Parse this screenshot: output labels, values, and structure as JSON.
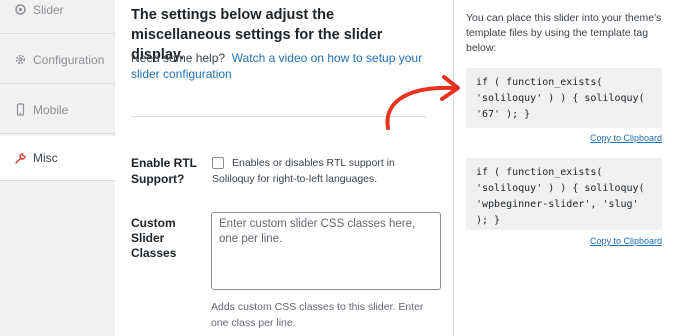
{
  "sidebar": {
    "items": [
      {
        "label": "Slider",
        "icon": "slider-icon"
      },
      {
        "label": "Configuration",
        "icon": "gear-icon"
      },
      {
        "label": "Mobile",
        "icon": "mobile-icon"
      },
      {
        "label": "Misc",
        "icon": "wrench-icon"
      }
    ],
    "active_item": "Misc",
    "active_icon_color": "#d63638"
  },
  "main": {
    "heading": "The settings below adjust the miscellaneous settings for the slider display.",
    "help_prefix": "Need some help?",
    "help_link": "Watch a video on how to setup your slider configuration",
    "rtl": {
      "label": "Enable RTL Support?",
      "checked": false,
      "description": "Enables or disables RTL support in Soliloquy for right-to-left languages."
    },
    "css_classes": {
      "label": "Custom Slider Classes",
      "value": "",
      "placeholder": "Enter custom slider CSS classes here, one per line.",
      "description": "Adds custom CSS classes to this slider. Enter one class per line."
    }
  },
  "right_panel": {
    "intro": "You can place this slider into your theme's template files by using the template tag below:",
    "snippets": [
      {
        "code": "if ( function_exists(\n'soliloquy' ) ) { soliloquy(\n'67' ); }",
        "copy_label": "Copy to Clipboard"
      },
      {
        "code": "if ( function_exists(\n'soliloquy' ) ) { soliloquy(\n'wpbeginner-slider', 'slug'\n); }",
        "copy_label": "Copy to Clipboard"
      }
    ]
  },
  "colors": {
    "link": "#2271b1",
    "annotation_arrow": "#e8321e"
  }
}
